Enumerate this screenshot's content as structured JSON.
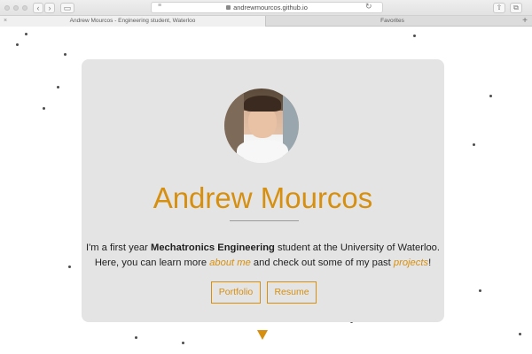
{
  "browser": {
    "url": "andrewmourcos.github.io",
    "tabs": [
      {
        "label": "Andrew Mourcos - Engineering student, Waterloo",
        "active": true
      },
      {
        "label": "Favorites",
        "active": false
      }
    ],
    "icons": [
      "back-icon",
      "forward-icon",
      "sidebar-icon",
      "reader-icon",
      "lock-icon",
      "reload-icon",
      "share-icon",
      "tabs-icon",
      "new-tab-icon"
    ]
  },
  "profile": {
    "name": "Andrew Mourcos",
    "bio_line1_pre": "I'm a first year ",
    "bio_line1_bold": "Mechatronics Engineering",
    "bio_line1_post": " student at the University of Waterloo.",
    "bio_line2_pre": "Here, you can learn more ",
    "bio_line2_link1": "about me",
    "bio_line2_mid": " and check out some of my past ",
    "bio_line2_link2": "projects",
    "bio_line2_post": "!"
  },
  "buttons": {
    "portfolio": "Portfolio",
    "resume": "Resume"
  },
  "colors": {
    "accent": "#d68f0f",
    "card": "#e4e4e4",
    "text": "#1f1f1f"
  }
}
